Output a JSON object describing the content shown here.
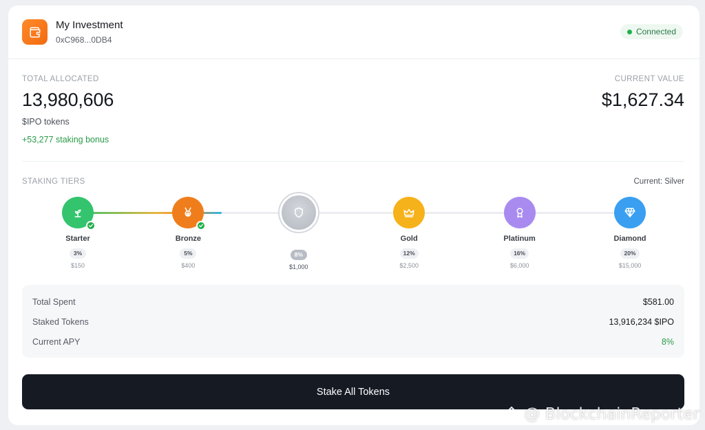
{
  "header": {
    "title": "My Investment",
    "address": "0xC968...0DB4",
    "status": "Connected",
    "wallet_icon": "wallet-icon"
  },
  "allocation": {
    "label": "TOTAL ALLOCATED",
    "value": "13,980,606",
    "unit": "$IPO tokens",
    "bonus": "+53,277 staking bonus"
  },
  "current_value": {
    "label": "CURRENT VALUE",
    "value": "$1,627.34"
  },
  "staking": {
    "label": "STAKING TIERS",
    "current": "Current: Silver",
    "progress_fraction": 0.26,
    "tiers": [
      {
        "name": "Starter",
        "pct": "3%",
        "price": "$150",
        "icon": "sprout-icon",
        "color": "#34c46e",
        "achieved": true,
        "current": false
      },
      {
        "name": "Bronze",
        "pct": "5%",
        "price": "$400",
        "icon": "medal-icon",
        "color": "#f07d1c",
        "achieved": true,
        "current": false
      },
      {
        "name": "",
        "pct": "8%",
        "price": "$1,000",
        "icon": "shield-icon",
        "color": "#c2c6cd",
        "achieved": false,
        "current": true
      },
      {
        "name": "Gold",
        "pct": "12%",
        "price": "$2,500",
        "icon": "crown-icon",
        "color": "#f6b21b",
        "achieved": false,
        "current": false
      },
      {
        "name": "Platinum",
        "pct": "16%",
        "price": "$6,000",
        "icon": "award-icon",
        "color": "#a98bf0",
        "achieved": false,
        "current": false
      },
      {
        "name": "Diamond",
        "pct": "20%",
        "price": "$15,000",
        "icon": "diamond-icon",
        "color": "#3a9ff0",
        "achieved": false,
        "current": false
      }
    ]
  },
  "summary": {
    "rows": [
      {
        "label": "Total Spent",
        "value": "$581.00",
        "accent": false
      },
      {
        "label": "Staked Tokens",
        "value": "13,916,234 $IPO",
        "accent": false
      },
      {
        "label": "Current APY",
        "value": "8%",
        "accent": true
      }
    ]
  },
  "action": {
    "stake_label": "Stake All Tokens"
  },
  "watermark": {
    "text": "@ BlockchainReporter"
  }
}
